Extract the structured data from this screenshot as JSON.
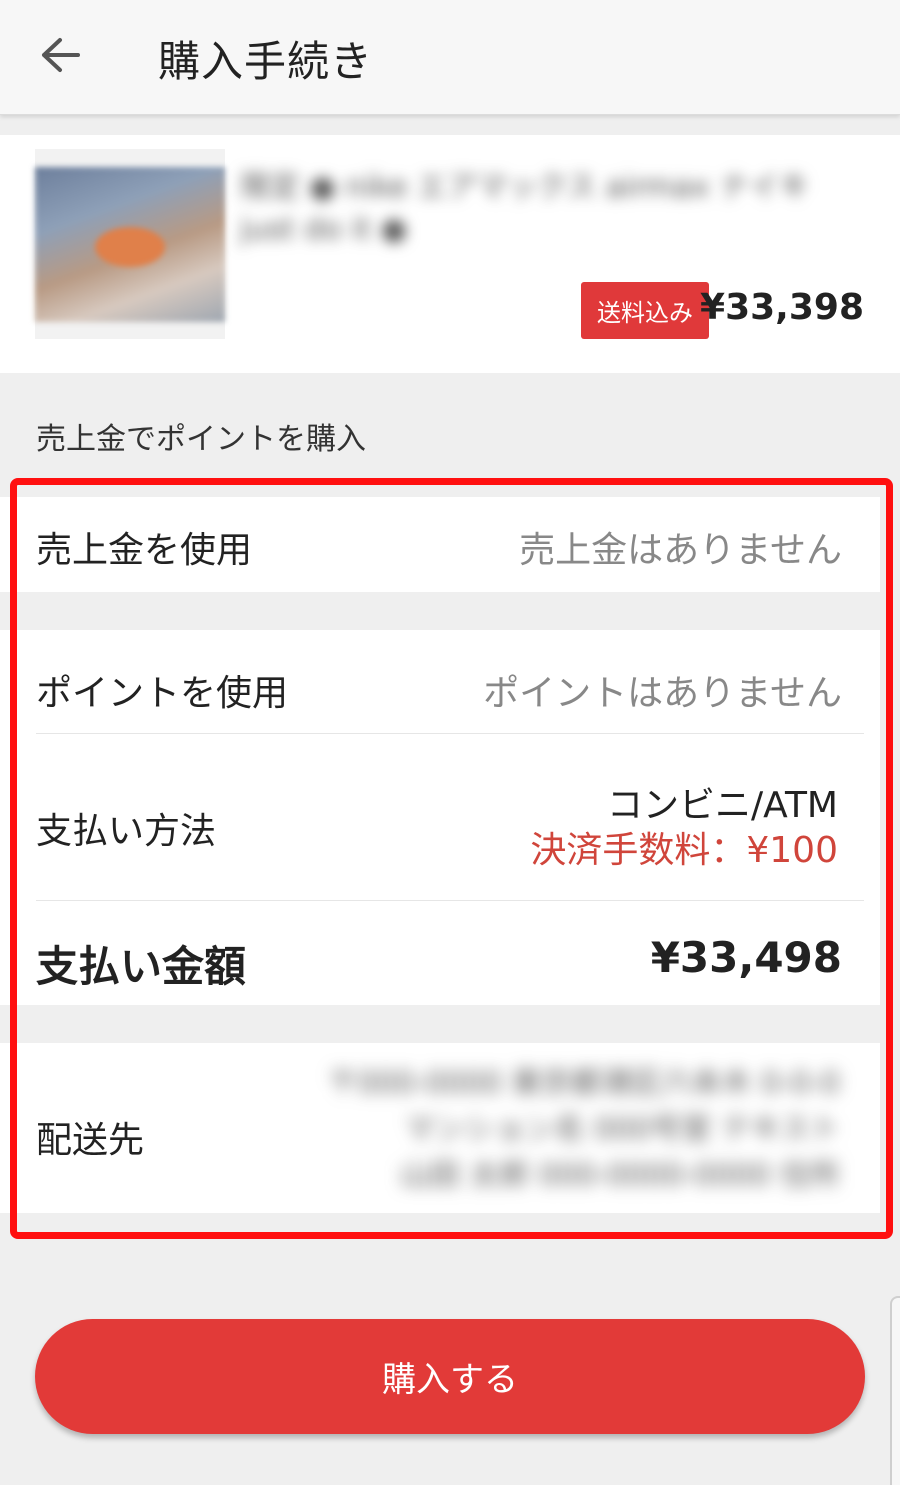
{
  "header": {
    "title": "購入手続き",
    "back_icon": "arrow-left-icon"
  },
  "product": {
    "name": "限定 ● nike エアマックス airmax ナイキ just do it ●",
    "badge": "送料込み",
    "price": "¥33,398"
  },
  "section": {
    "label": "売上金でポイントを購入"
  },
  "rows": {
    "sales_label": "売上金を使用",
    "sales_value": "売上金はありません",
    "points_label": "ポイントを使用",
    "points_value": "ポイントはありません",
    "payment_label": "支払い方法",
    "payment_method": "コンビニ/ATM",
    "payment_fee": "決済手数料：¥100",
    "total_label": "支払い金額",
    "total_value": "¥33,498",
    "address_label": "配送先",
    "address_line1": "〒000-0000 東京都港区六本木 0-0-0",
    "address_line2": "マンション名 000号室 テキスト",
    "address_line3": "山田 太郎 000-0000-0000 住所"
  },
  "actions": {
    "purchase_label": "購入する"
  },
  "colors": {
    "accent": "#e23a38",
    "highlight": "#ff1010",
    "fee_text": "#d0453b"
  }
}
